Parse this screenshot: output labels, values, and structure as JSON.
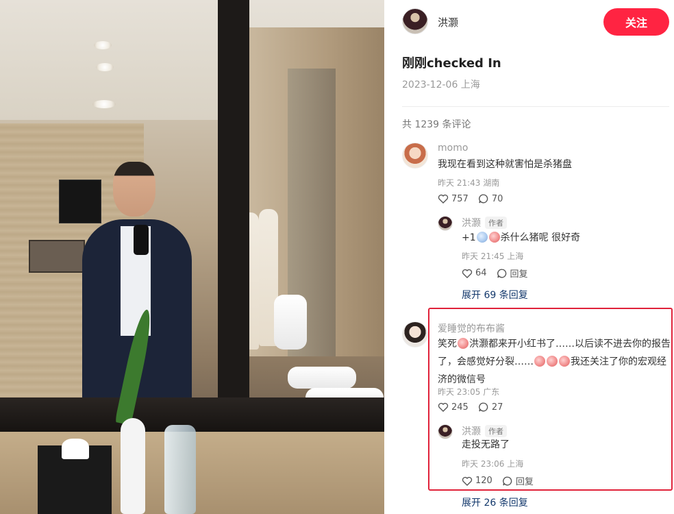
{
  "post": {
    "author_name": "洪灏",
    "follow_label": "关注",
    "title": "刚刚checked In",
    "meta": "2023-12-06 上海",
    "total_comments": "共 1239 条评论"
  },
  "comments": [
    {
      "user": "momo",
      "text": "我现在看到这种就害怕是杀猪盘",
      "time": "昨天 21:43 湖南",
      "likes": "757",
      "replies": "70",
      "reply": {
        "user": "洪灏",
        "tag": "作者",
        "text_pre": "+1",
        "text_post": "杀什么猪呢 很好奇",
        "time": "昨天 21:45 上海",
        "likes": "64",
        "reply_label": "回复"
      },
      "expand": "展开 69 条回复"
    },
    {
      "user": "爱睡觉的布布酱",
      "text_1": "笑死",
      "text_2": "洪灏都来开小红书了……以后读不进去你的报告",
      "text_3": "了，会感觉好分裂……",
      "text_4": "我还关注了你的宏观经",
      "text_5": "济的微信号",
      "time": "昨天 23:05 广东",
      "likes": "245",
      "replies": "27",
      "reply": {
        "user": "洪灏",
        "tag": "作者",
        "text": "走投无路了",
        "time": "昨天 23:06 上海",
        "likes": "120",
        "reply_label": "回复"
      },
      "expand": "展开 26 条回复"
    }
  ],
  "colors": {
    "accent": "#ff2442",
    "highlight": "#e0223a",
    "link": "#13386c"
  }
}
